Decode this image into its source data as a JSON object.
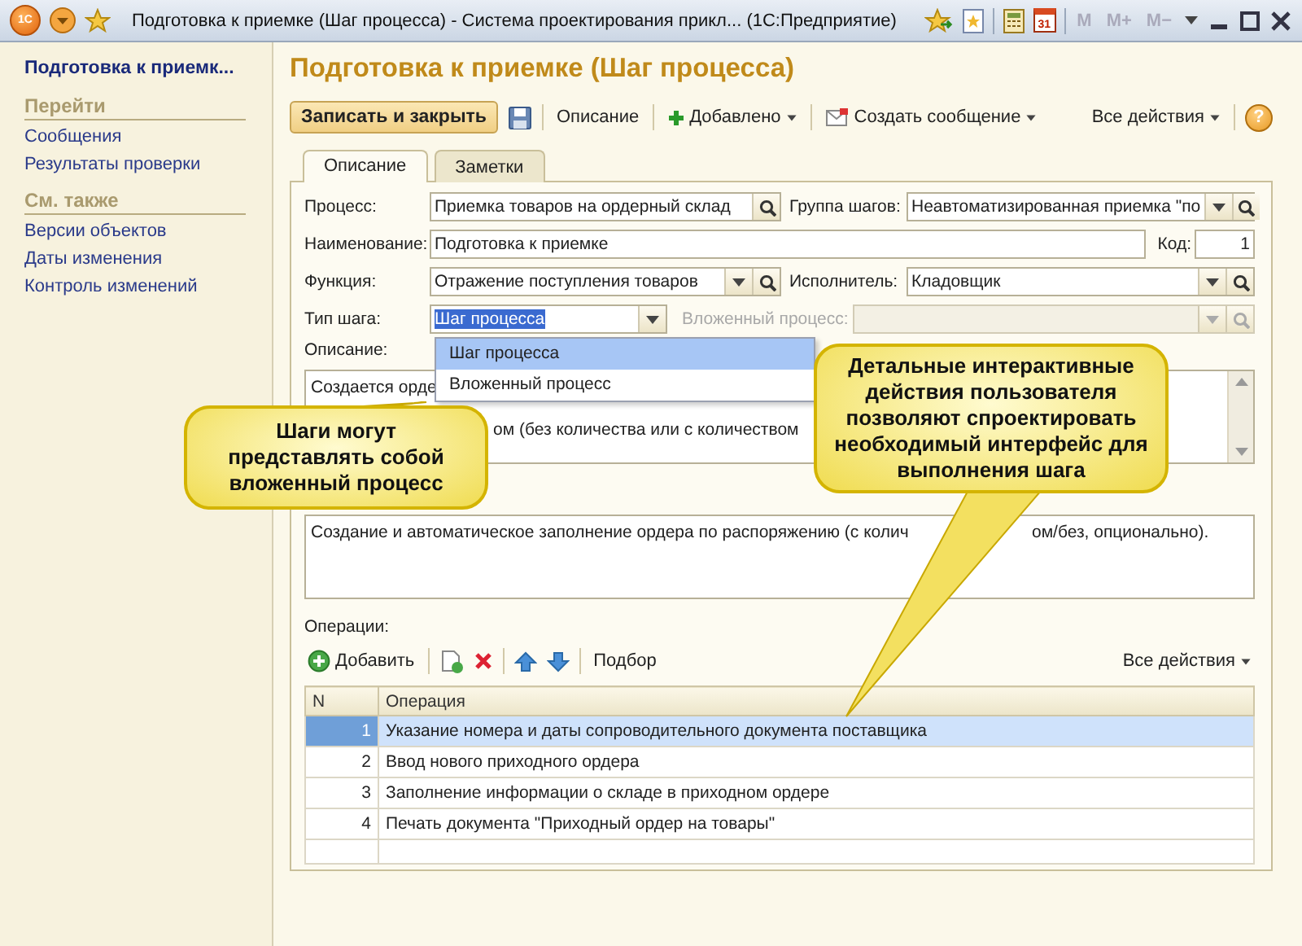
{
  "window": {
    "app_logo": "1С",
    "title": "Подготовка к приемке (Шаг процесса) - Система проектирования прикл...  (1С:Предприятие)",
    "calendar_day": "31",
    "memory_buttons": [
      "M",
      "M+",
      "M−"
    ]
  },
  "sidebar": {
    "title": "Подготовка к приемк...",
    "sections": [
      {
        "heading": "Перейти",
        "items": [
          "Сообщения",
          "Результаты проверки"
        ]
      },
      {
        "heading": "См. также",
        "items": [
          "Версии объектов",
          "Даты изменения",
          "Контроль изменений"
        ]
      }
    ]
  },
  "form": {
    "title": "Подготовка к приемке (Шаг процесса)",
    "toolbar": {
      "primary": "Записать и закрыть",
      "items": [
        {
          "label": "Описание",
          "kind": "plain"
        },
        {
          "label": "Добавлено",
          "kind": "add"
        },
        {
          "label": "Создать сообщение",
          "kind": "message"
        }
      ],
      "all_actions": "Все действия",
      "help": "?"
    },
    "tabs": [
      {
        "label": "Описание",
        "selected": true
      },
      {
        "label": "Заметки",
        "selected": false
      }
    ],
    "fields": {
      "process": {
        "label": "Процесс:",
        "value": "Приемка товаров на ордерный склад"
      },
      "step_group": {
        "label": "Группа шагов:",
        "value": "Неавтоматизированная приемка \"по"
      },
      "name": {
        "label": "Наименование:",
        "value": "Подготовка к приемке"
      },
      "code": {
        "label": "Код:",
        "value": "1"
      },
      "function": {
        "label": "Функция:",
        "value": "Отражение поступления товаров"
      },
      "executor": {
        "label": "Исполнитель:",
        "value": "Кладовщик"
      },
      "step_type": {
        "label": "Тип шага:",
        "value": "Шаг процесса",
        "text_selected": true
      },
      "nested_process": {
        "label": "Вложенный процесс:",
        "disabled": true
      }
    },
    "dropdown": {
      "options": [
        {
          "label": "Шаг процесса",
          "selected": true
        },
        {
          "label": "Вложенный процесс",
          "selected": false
        }
      ]
    },
    "description": {
      "label": "Описание:",
      "visible_text": [
        "Создается орде",
        "ом (без количества или с количеством"
      ]
    },
    "requirements": {
      "visible_text": [
        "Создание и автоматическое заполнение ордера по распоряжению (с колич",
        "ом/без, опционально)."
      ]
    },
    "operations": {
      "label": "Операции:",
      "toolbar": {
        "add": "Добавить",
        "pick": "Подбор",
        "all_actions": "Все действия"
      },
      "columns": [
        "N",
        "Операция"
      ],
      "rows": [
        {
          "n": "1",
          "operation": "Указание номера и даты сопроводительного документа поставщика",
          "selected": true
        },
        {
          "n": "2",
          "operation": "Ввод нового приходного ордера",
          "selected": false
        },
        {
          "n": "3",
          "operation": "Заполнение информации о складе в приходном ордере",
          "selected": false
        },
        {
          "n": "4",
          "operation": "Печать документа \"Приходный ордер на товары\"",
          "selected": false
        }
      ]
    }
  },
  "callouts": [
    {
      "text": "Шаги могут представлять собой вложенный процесс"
    },
    {
      "text": "Детальные интерактивные действия пользователя позволяют спроектировать необходимый интерфейс для выполнения шага"
    }
  ]
}
